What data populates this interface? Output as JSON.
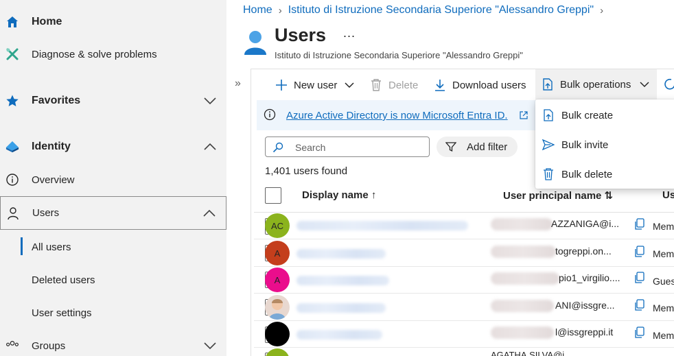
{
  "sidebar": {
    "home": "Home",
    "diagnose": "Diagnose & solve problems",
    "favorites": "Favorites",
    "identity": "Identity",
    "overview": "Overview",
    "users": "Users",
    "all_users": "All users",
    "deleted_users": "Deleted users",
    "user_settings": "User settings",
    "groups": "Groups"
  },
  "breadcrumb": {
    "home": "Home",
    "org": "Istituto di Istruzione Secondaria Superiore \"Alessandro Greppi\""
  },
  "page": {
    "title": "Users",
    "more": "...",
    "subtitle": "Istituto di Istruzione Secondaria Superiore \"Alessandro Greppi\""
  },
  "toolbar": {
    "new_user": "New user",
    "delete": "Delete",
    "download": "Download users",
    "bulk": "Bulk operations"
  },
  "banner": {
    "text": "Azure Active Directory is now Microsoft Entra ID."
  },
  "search": {
    "placeholder": "Search"
  },
  "filter": {
    "label": "Add filter"
  },
  "results": {
    "count": "1,401 users found"
  },
  "table": {
    "columns": {
      "display_name": "Display name ↑",
      "upn": "User principal name ⇅",
      "type": "Us"
    },
    "rows": [
      {
        "initials": "AC",
        "upn": "AZZANIGA@i...",
        "type": "Mem"
      },
      {
        "initials": "A",
        "upn": "togreppi.on...",
        "type": "Mem"
      },
      {
        "initials": "A",
        "upn": "pio1_virgilio....",
        "type": "Gues"
      },
      {
        "initials": "",
        "upn": "ANI@issgre...",
        "type": "Mem"
      },
      {
        "initials": "",
        "upn": "l@issgreppi.it",
        "type": "Mem"
      },
      {
        "initials": "",
        "upn": "AGATHA.SILVA@i...",
        "type": ""
      }
    ]
  },
  "dropdown": {
    "items": [
      "Bulk create",
      "Bulk invite",
      "Bulk delete"
    ]
  },
  "colors": {
    "accent": "#0f6cbd",
    "avatar_ac": "#8bb31d",
    "avatar_orange": "#c43e1c",
    "avatar_pink": "#ea0d8c",
    "avatar_black": "#000000"
  }
}
